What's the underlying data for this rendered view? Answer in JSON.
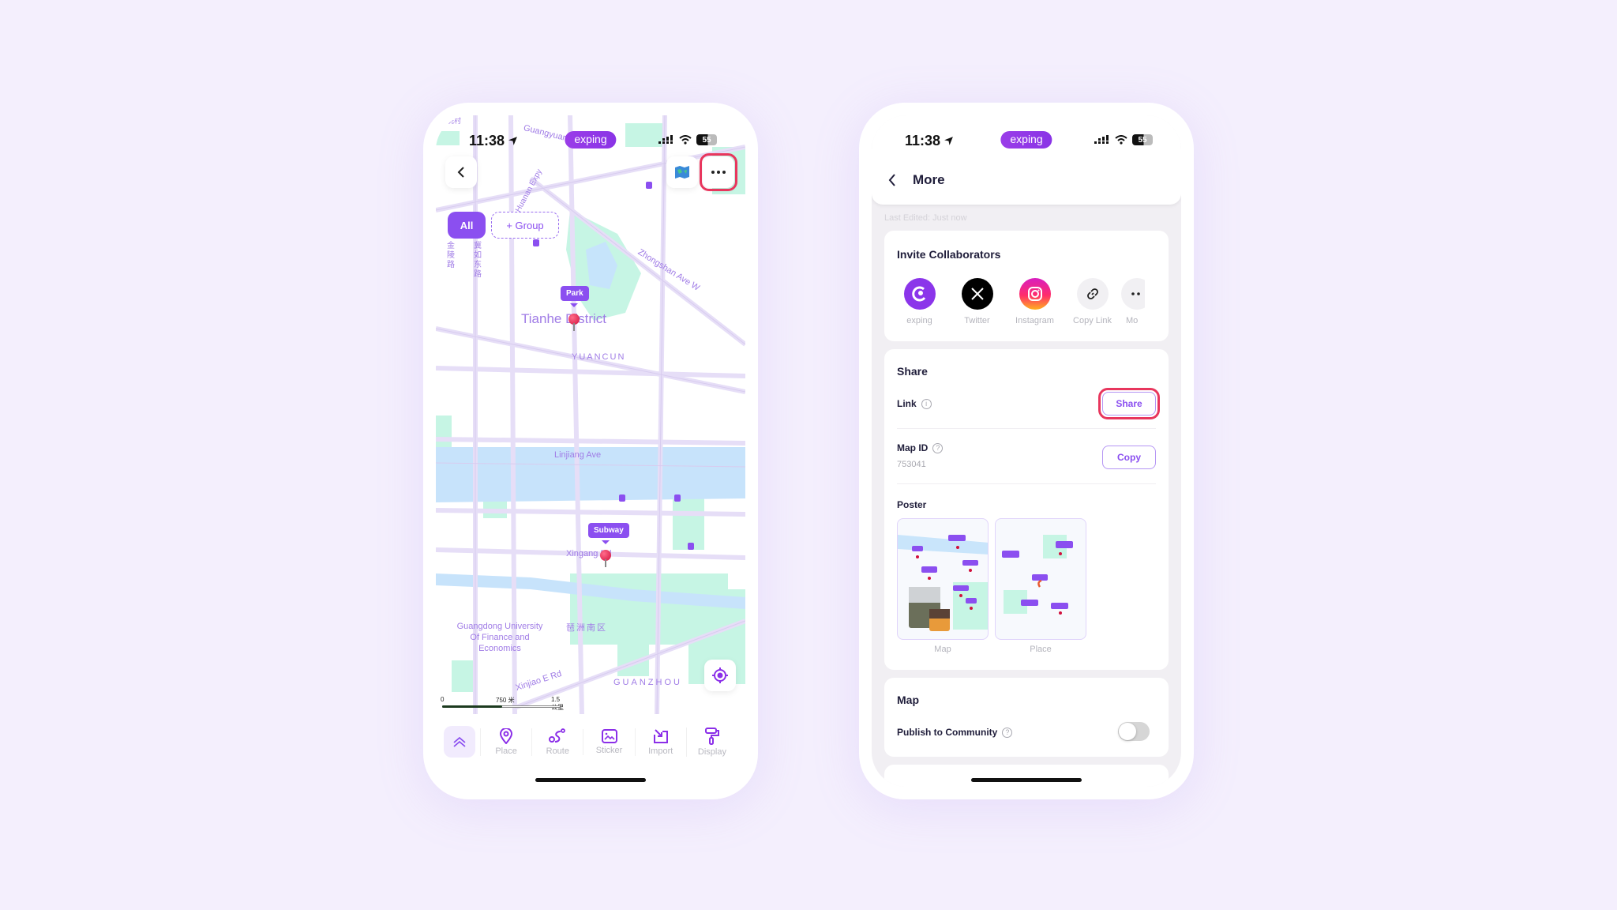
{
  "status_bar": {
    "time": "11:38",
    "brand": "exping",
    "battery": "55"
  },
  "map_screen": {
    "filters": {
      "all_label": "All",
      "group_label": "+ Group"
    },
    "pins": [
      {
        "label": "Park"
      },
      {
        "label": "Subway"
      }
    ],
    "map_labels": {
      "district": "Tianhe District",
      "yuancun": "YUANCUN",
      "guangyuan": "Guangyuan Expy",
      "huanan": "Huanan Expy",
      "zhongshan": "Zhongshan Ave W",
      "linjiang": "Linjiang Ave",
      "xingang": "Xingang Rd",
      "university": "Guangdong University Of Finance and Economics",
      "pazhou": "琶洲南区",
      "xinjiao": "Xinjiao E Rd",
      "guanzhou": "GUANZHOU",
      "jinling": "金陵路",
      "tianhe_road": "冀如东路",
      "top_left": "冼村"
    },
    "scale": {
      "zero": "0",
      "mid": "750 米",
      "end": "1.5 公里"
    },
    "toolbar": [
      {
        "label": "Place",
        "icon": "pin-icon"
      },
      {
        "label": "Route",
        "icon": "route-icon"
      },
      {
        "label": "Sticker",
        "icon": "image-icon"
      },
      {
        "label": "Import",
        "icon": "import-icon"
      },
      {
        "label": "Display",
        "icon": "paint-roller-icon"
      }
    ]
  },
  "more_screen": {
    "title": "More",
    "last_edited": "Last Edited: Just now",
    "invite": {
      "title": "Invite Collaborators",
      "items": [
        {
          "label": "exping",
          "color": "#8b35ea"
        },
        {
          "label": "Twitter",
          "color": "#000000"
        },
        {
          "label": "Instagram",
          "color": "#e8248c"
        },
        {
          "label": "Copy Link",
          "color": "#f1f0f3"
        },
        {
          "label": "Mo",
          "color": "#f1f0f3"
        }
      ]
    },
    "share": {
      "title": "Share",
      "link_label": "Link",
      "share_button": "Share",
      "map_id_label": "Map ID",
      "map_id_value": "753041",
      "copy_button": "Copy",
      "poster_label": "Poster",
      "posters": [
        {
          "label": "Map"
        },
        {
          "label": "Place"
        }
      ]
    },
    "map_section": {
      "title": "Map",
      "publish_label": "Publish to Community",
      "publish_enabled": false
    }
  },
  "colors": {
    "accent": "#8b4ff0",
    "highlight": "#e8365d",
    "background": "#f4effd"
  }
}
